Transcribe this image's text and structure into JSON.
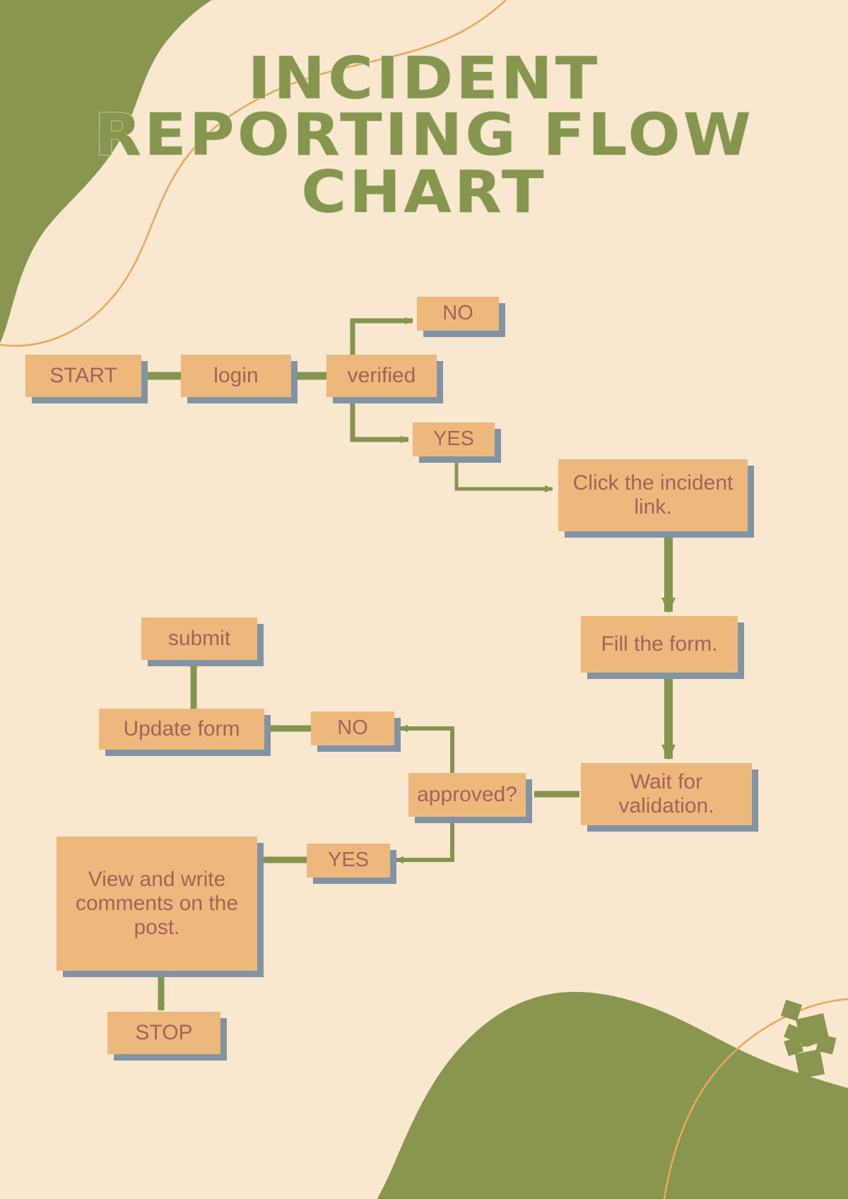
{
  "poster": {
    "title_lines": [
      "INCIDENT",
      "REPORTING FLOW",
      "CHART"
    ],
    "background_color": "#FAE7D0",
    "title_color": "#87964E",
    "node_fill_color": "#EDB87C",
    "node_text_color": "#A4625B",
    "node_shadow_color": "#8293A4",
    "connector_color": "#84954F",
    "decoration_green": "#89964F",
    "decoration_orange": "#E9A95D"
  },
  "chart_data": {
    "type": "diagram",
    "title": "INCIDENT REPORTING FLOW CHART",
    "diagram_kind": "flowchart",
    "nodes": [
      {
        "id": "start",
        "label": "START",
        "kind": "terminator"
      },
      {
        "id": "login",
        "label": "login",
        "kind": "process"
      },
      {
        "id": "verified",
        "label": "verified",
        "kind": "decision"
      },
      {
        "id": "no1",
        "label": "NO",
        "kind": "branch-label"
      },
      {
        "id": "yes1",
        "label": "YES",
        "kind": "branch-label"
      },
      {
        "id": "click",
        "label": "Click the incident link.",
        "kind": "process"
      },
      {
        "id": "fill",
        "label": "Fill the form.",
        "kind": "process"
      },
      {
        "id": "wait",
        "label": "Wait for validation.",
        "kind": "process"
      },
      {
        "id": "approved",
        "label": "approved?",
        "kind": "decision"
      },
      {
        "id": "no2",
        "label": "NO",
        "kind": "branch-label"
      },
      {
        "id": "update",
        "label": "Update form",
        "kind": "process"
      },
      {
        "id": "submit",
        "label": "submit",
        "kind": "process"
      },
      {
        "id": "yes2",
        "label": "YES",
        "kind": "branch-label"
      },
      {
        "id": "view",
        "label": "View and write comments on the post.",
        "kind": "process"
      },
      {
        "id": "stop",
        "label": "STOP",
        "kind": "terminator"
      }
    ],
    "edges": [
      {
        "from": "start",
        "to": "login",
        "label": ""
      },
      {
        "from": "login",
        "to": "verified",
        "label": ""
      },
      {
        "from": "verified",
        "to": "no1",
        "label": ""
      },
      {
        "from": "verified",
        "to": "yes1",
        "label": ""
      },
      {
        "from": "yes1",
        "to": "click",
        "label": ""
      },
      {
        "from": "click",
        "to": "fill",
        "label": ""
      },
      {
        "from": "fill",
        "to": "wait",
        "label": ""
      },
      {
        "from": "wait",
        "to": "approved",
        "label": ""
      },
      {
        "from": "approved",
        "to": "no2",
        "label": ""
      },
      {
        "from": "no2",
        "to": "update",
        "label": ""
      },
      {
        "from": "update",
        "to": "submit",
        "label": ""
      },
      {
        "from": "approved",
        "to": "yes2",
        "label": ""
      },
      {
        "from": "yes2",
        "to": "view",
        "label": ""
      },
      {
        "from": "view",
        "to": "stop",
        "label": ""
      }
    ]
  },
  "nodes": {
    "start": {
      "label": "START"
    },
    "login": {
      "label": "login"
    },
    "verified": {
      "label": "verified"
    },
    "no1": {
      "label": "NO"
    },
    "yes1": {
      "label": "YES"
    },
    "click": {
      "label": "Click the incident link."
    },
    "fill": {
      "label": "Fill the form."
    },
    "wait": {
      "label": "Wait for validation."
    },
    "approved": {
      "label": "approved?"
    },
    "no2": {
      "label": "NO"
    },
    "update": {
      "label": "Update form"
    },
    "submit": {
      "label": "submit"
    },
    "yes2": {
      "label": "YES"
    },
    "view": {
      "label": "View and write comments on the post."
    },
    "stop": {
      "label": "STOP"
    }
  }
}
